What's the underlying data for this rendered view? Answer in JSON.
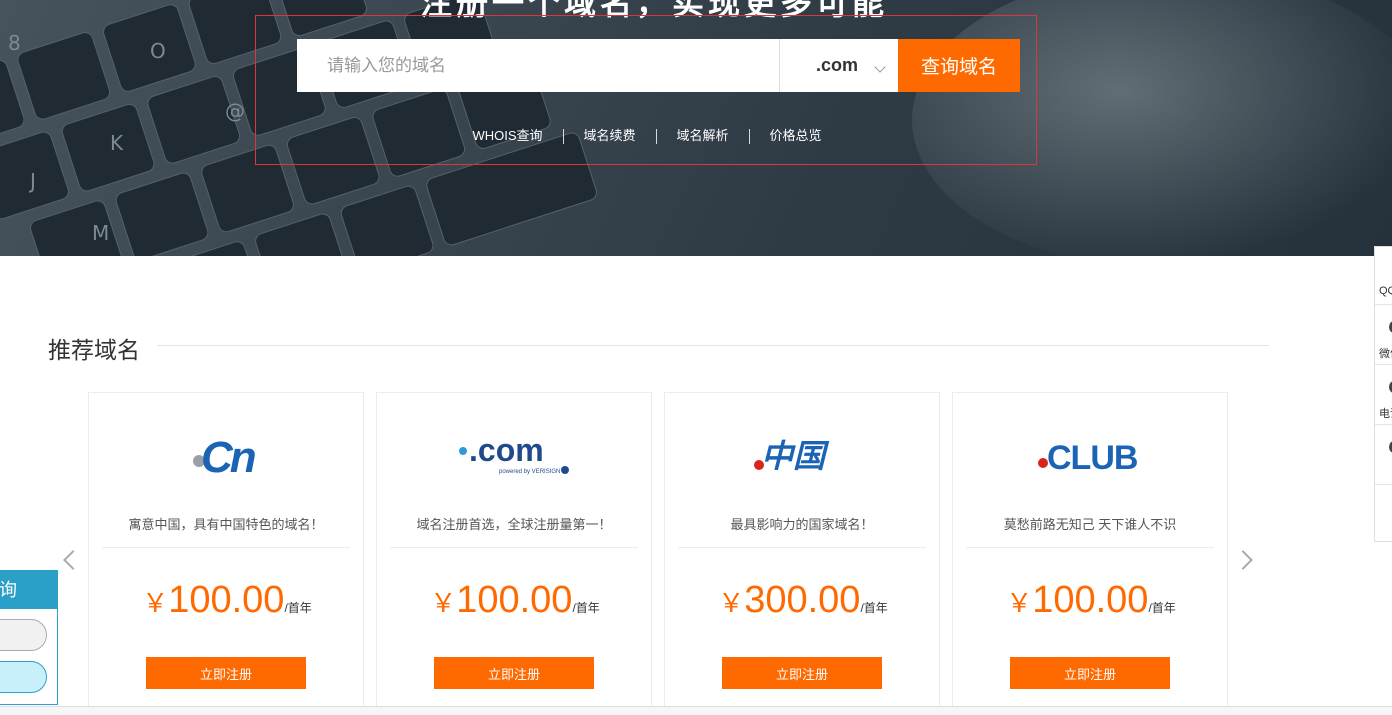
{
  "hero": {
    "title": "注册一个域名，实现更多可能",
    "search": {
      "placeholder": "请输入您的域名",
      "suffix": ".com",
      "button_label": "查询域名"
    },
    "links": [
      "WHOIS查询",
      "域名续费",
      "域名解析",
      "价格总览"
    ]
  },
  "section": {
    "title": "推荐域名"
  },
  "cards": [
    {
      "logo": "Cn",
      "desc": "寓意中国，具有中国特色的域名！",
      "currency": "￥",
      "price": "100.00",
      "unit": "/首年",
      "button": "立即注册"
    },
    {
      "logo": ".com",
      "logo_sub": "powered by VERISIGN",
      "desc": "域名注册首选，全球注册量第一！",
      "currency": "￥",
      "price": "100.00",
      "unit": "/首年",
      "button": "立即注册"
    },
    {
      "logo": "中国",
      "desc": "最具影响力的国家域名！",
      "currency": "￥",
      "price": "300.00",
      "unit": "/首年",
      "button": "立即注册"
    },
    {
      "logo": "CLUB",
      "desc": "莫愁前路无知己 天下谁人不识",
      "currency": "￥",
      "price": "100.00",
      "unit": "/首年",
      "button": "立即注册"
    }
  ],
  "left_widget": {
    "title": "询"
  },
  "right_bar": {
    "items": [
      "QQ",
      "微信",
      "电话"
    ]
  },
  "colors": {
    "accent": "#ff6a00",
    "widget_blue": "#2aa0c8",
    "search_border": "#d9363e"
  }
}
